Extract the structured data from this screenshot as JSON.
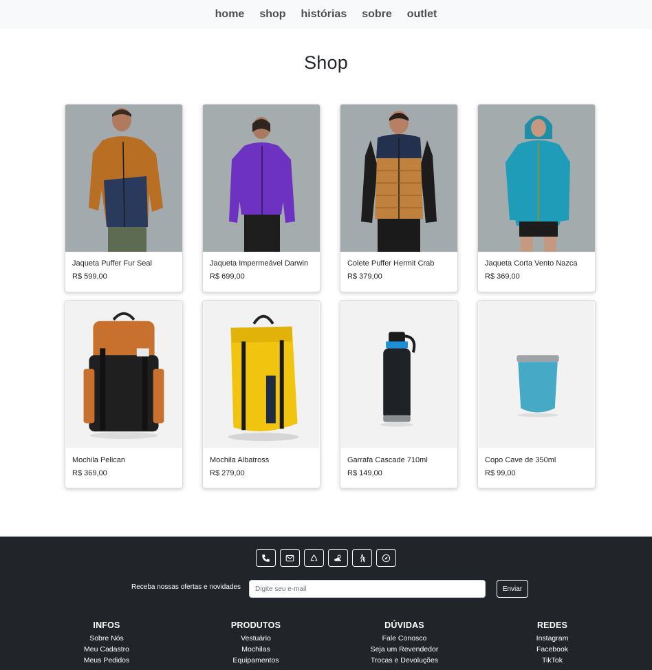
{
  "nav": {
    "items": [
      {
        "label": "home"
      },
      {
        "label": "shop"
      },
      {
        "label": "histórias"
      },
      {
        "label": "sobre"
      },
      {
        "label": "outlet"
      }
    ]
  },
  "page": {
    "title": "Shop"
  },
  "products": [
    {
      "name": "Jaqueta Puffer Fur Seal",
      "price": "R$ 599,00"
    },
    {
      "name": "Jaqueta Impermeável Darwin",
      "price": "R$ 699,00"
    },
    {
      "name": "Colete Puffer Hermit Crab",
      "price": "R$ 379,00"
    },
    {
      "name": "Jaqueta Corta Vento Nazca",
      "price": "R$ 369,00"
    },
    {
      "name": "Mochila Pelican",
      "price": "R$ 369,00"
    },
    {
      "name": "Mochila Albatross",
      "price": "R$ 279,00"
    },
    {
      "name": "Garrafa Cascade 710ml",
      "price": "R$ 149,00"
    },
    {
      "name": "Copo Cave de 350ml",
      "price": "R$ 99,00"
    }
  ],
  "footer": {
    "icons": [
      "phone-icon",
      "mail-icon",
      "recycle-icon",
      "cloud-sun-icon",
      "hiking-icon",
      "compass-icon"
    ],
    "newsletter": {
      "label": "Receba nossas ofertas e novidades",
      "placeholder": "Digite seu e-mail",
      "button": "Enviar"
    },
    "columns": [
      {
        "title": "INFOS",
        "links": [
          "Sobre Nós",
          "Meu Cadastro",
          "Meus Pedidos"
        ]
      },
      {
        "title": "PRODUTOS",
        "links": [
          "Vestuário",
          "Mochilas",
          "Equipamentos"
        ]
      },
      {
        "title": "DÚVIDAS",
        "links": [
          "Fale Conosco",
          "Seja um Revendedor",
          "Trocas e Devoluções"
        ]
      },
      {
        "title": "REDES",
        "links": [
          "Instagram",
          "Facebook",
          "TikTok"
        ]
      }
    ]
  },
  "colors": {
    "nav_bg": "#f8f9fa",
    "footer_bg": "#212529",
    "apparel_photo_bg": "#a3aaad",
    "product_photo_bg": "#f2f2f2"
  }
}
